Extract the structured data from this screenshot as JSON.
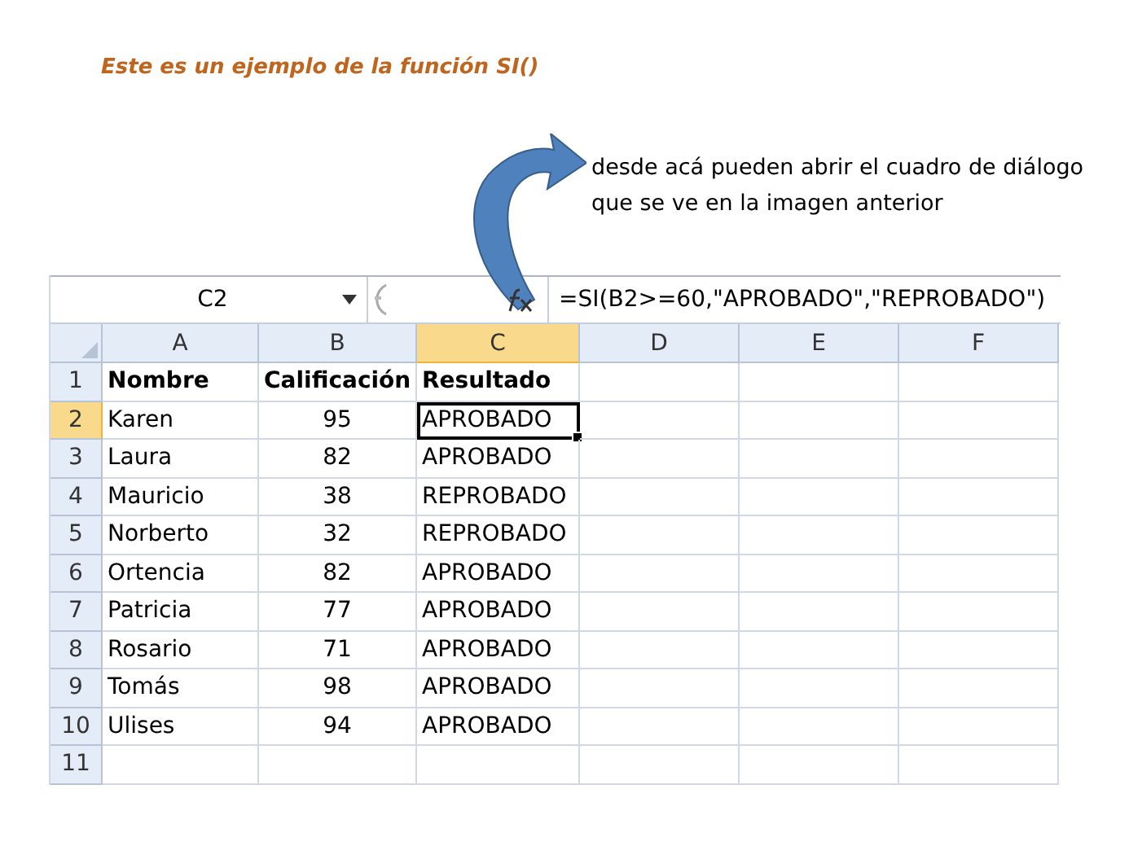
{
  "title": "Este es un ejemplo de la función SI()",
  "note": {
    "lines": [
      "desde acá pueden abrir el cuadro de diálogo",
      "que se ve en la imagen anterior"
    ]
  },
  "spreadsheet": {
    "name_box": "C2",
    "formula": "=SI(B2>=60,\"APROBADO\",\"REPROBADO\")",
    "columns": [
      {
        "label": "A",
        "selected": false
      },
      {
        "label": "B",
        "selected": false
      },
      {
        "label": "C",
        "selected": true
      },
      {
        "label": "D",
        "selected": false
      },
      {
        "label": "E",
        "selected": false
      },
      {
        "label": "F",
        "selected": false
      }
    ],
    "rows": [
      {
        "header": "1",
        "selected": false,
        "kind": "header",
        "cells": [
          {
            "text": "Nombre",
            "selected": false
          },
          {
            "text": "Calificación",
            "selected": false
          },
          {
            "text": "Resultado",
            "selected": false
          }
        ]
      },
      {
        "header": "2",
        "selected": true,
        "kind": "data",
        "cells": [
          {
            "text": "Karen",
            "selected": false
          },
          {
            "text": "95",
            "selected": false
          },
          {
            "text": "APROBADO",
            "selected": true
          }
        ]
      },
      {
        "header": "3",
        "selected": false,
        "kind": "data",
        "cells": [
          {
            "text": "Laura",
            "selected": false
          },
          {
            "text": "82",
            "selected": false
          },
          {
            "text": "APROBADO",
            "selected": false
          }
        ]
      },
      {
        "header": "4",
        "selected": false,
        "kind": "data",
        "cells": [
          {
            "text": "Mauricio",
            "selected": false
          },
          {
            "text": "38",
            "selected": false
          },
          {
            "text": "REPROBADO",
            "selected": false
          }
        ]
      },
      {
        "header": "5",
        "selected": false,
        "kind": "data",
        "cells": [
          {
            "text": "Norberto",
            "selected": false
          },
          {
            "text": "32",
            "selected": false
          },
          {
            "text": "REPROBADO",
            "selected": false
          }
        ]
      },
      {
        "header": "6",
        "selected": false,
        "kind": "data",
        "cells": [
          {
            "text": "Ortencia",
            "selected": false
          },
          {
            "text": "82",
            "selected": false
          },
          {
            "text": "APROBADO",
            "selected": false
          }
        ]
      },
      {
        "header": "7",
        "selected": false,
        "kind": "data",
        "cells": [
          {
            "text": "Patricia",
            "selected": false
          },
          {
            "text": "77",
            "selected": false
          },
          {
            "text": "APROBADO",
            "selected": false
          }
        ]
      },
      {
        "header": "8",
        "selected": false,
        "kind": "data",
        "cells": [
          {
            "text": "Rosario",
            "selected": false
          },
          {
            "text": "71",
            "selected": false
          },
          {
            "text": "APROBADO",
            "selected": false
          }
        ]
      },
      {
        "header": "9",
        "selected": false,
        "kind": "data",
        "cells": [
          {
            "text": "Tomás",
            "selected": false
          },
          {
            "text": "98",
            "selected": false
          },
          {
            "text": "APROBADO",
            "selected": false
          }
        ]
      },
      {
        "header": "10",
        "selected": false,
        "kind": "data",
        "cells": [
          {
            "text": "Ulises",
            "selected": false
          },
          {
            "text": "94",
            "selected": false
          },
          {
            "text": "APROBADO",
            "selected": false
          }
        ]
      },
      {
        "header": "11",
        "selected": false,
        "kind": "data"
      }
    ]
  }
}
